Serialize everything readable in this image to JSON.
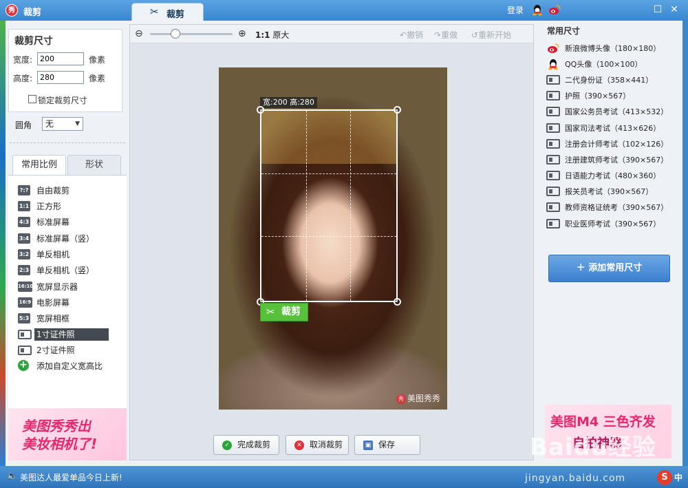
{
  "titlebar": {
    "app_logo": "秀",
    "app_title": "裁剪",
    "tab_label": "裁剪",
    "login": "登录"
  },
  "crop_size": {
    "title": "裁剪尺寸",
    "width_label": "宽度:",
    "width_value": "200",
    "height_label": "高度:",
    "height_value": "280",
    "unit": "像素",
    "lock_label": "锁定裁剪尺寸"
  },
  "corner": {
    "label": "圆角",
    "value": "无"
  },
  "panel_tabs": [
    "常用比例",
    "形状"
  ],
  "ratios": [
    {
      "badge": "?:?",
      "label": "自由裁剪"
    },
    {
      "badge": "1:1",
      "label": "正方形"
    },
    {
      "badge": "4:3",
      "label": "标准屏幕"
    },
    {
      "badge": "3:4",
      "label": "标准屏幕（竖）"
    },
    {
      "badge": "3:2",
      "label": "单反相机"
    },
    {
      "badge": "2:3",
      "label": "单反相机（竖）"
    },
    {
      "badge": "16:10",
      "label": "宽屏显示器"
    },
    {
      "badge": "16:9",
      "label": "电影屏幕"
    },
    {
      "badge": "5:3",
      "label": "宽屏相框"
    },
    {
      "badge": "card",
      "label": "1寸证件照"
    },
    {
      "badge": "card",
      "label": "2寸证件照"
    },
    {
      "badge": "plus",
      "label": "添加自定义宽高比"
    }
  ],
  "promo_left": {
    "line1": "美图秀秀出",
    "line2": "美妆相机了!"
  },
  "toolbar": {
    "ratio_bold": "1:1",
    "ratio_text": "原大",
    "undo": "撤销",
    "redo": "重做",
    "restart": "重新开始"
  },
  "crop_overlay": {
    "dimension": "宽:200 高:280",
    "button": "裁剪"
  },
  "watermark": {
    "seal": "秀",
    "text": "美图秀秀"
  },
  "bottom_buttons": {
    "finish": "完成裁剪",
    "cancel": "取消裁剪",
    "save": "保存"
  },
  "right_panel": {
    "title": "常用尺寸",
    "sizes": [
      {
        "icon": "weibo",
        "label": "新浪微博头像（180×180）"
      },
      {
        "icon": "qq",
        "label": "QQ头像（100×100）"
      },
      {
        "icon": "card",
        "label": "二代身份证（358×441）"
      },
      {
        "icon": "card",
        "label": "护照（390×567）"
      },
      {
        "icon": "card",
        "label": "国家公务员考试（413×532）"
      },
      {
        "icon": "card",
        "label": "国家司法考试（413×626）"
      },
      {
        "icon": "card",
        "label": "注册会计师考试（102×126）"
      },
      {
        "icon": "card",
        "label": "注册建筑师考试（390×567）"
      },
      {
        "icon": "card",
        "label": "日语能力考试（480×360）"
      },
      {
        "icon": "card",
        "label": "报关员考试（390×567）"
      },
      {
        "icon": "card",
        "label": "教师资格证统考（390×567）"
      },
      {
        "icon": "card",
        "label": "职业医师考试（390×567）"
      }
    ],
    "add_button": "添加常用尺寸"
  },
  "promo_right": {
    "line1": "美图M4 三色齐发",
    "line2": "自拍神器"
  },
  "baidu_watermark": "Baidu经验",
  "statusbar": {
    "text": "美图达人最爱单品今日上新!",
    "site": "jingyan.baidu.com",
    "ime": "S",
    "ime_lang": "中"
  },
  "colors": {
    "titlebar": "#3b86cf",
    "crop_button": "#58c13b",
    "add_button": "#3c7fcf",
    "promo_pink": "#e8256d"
  }
}
